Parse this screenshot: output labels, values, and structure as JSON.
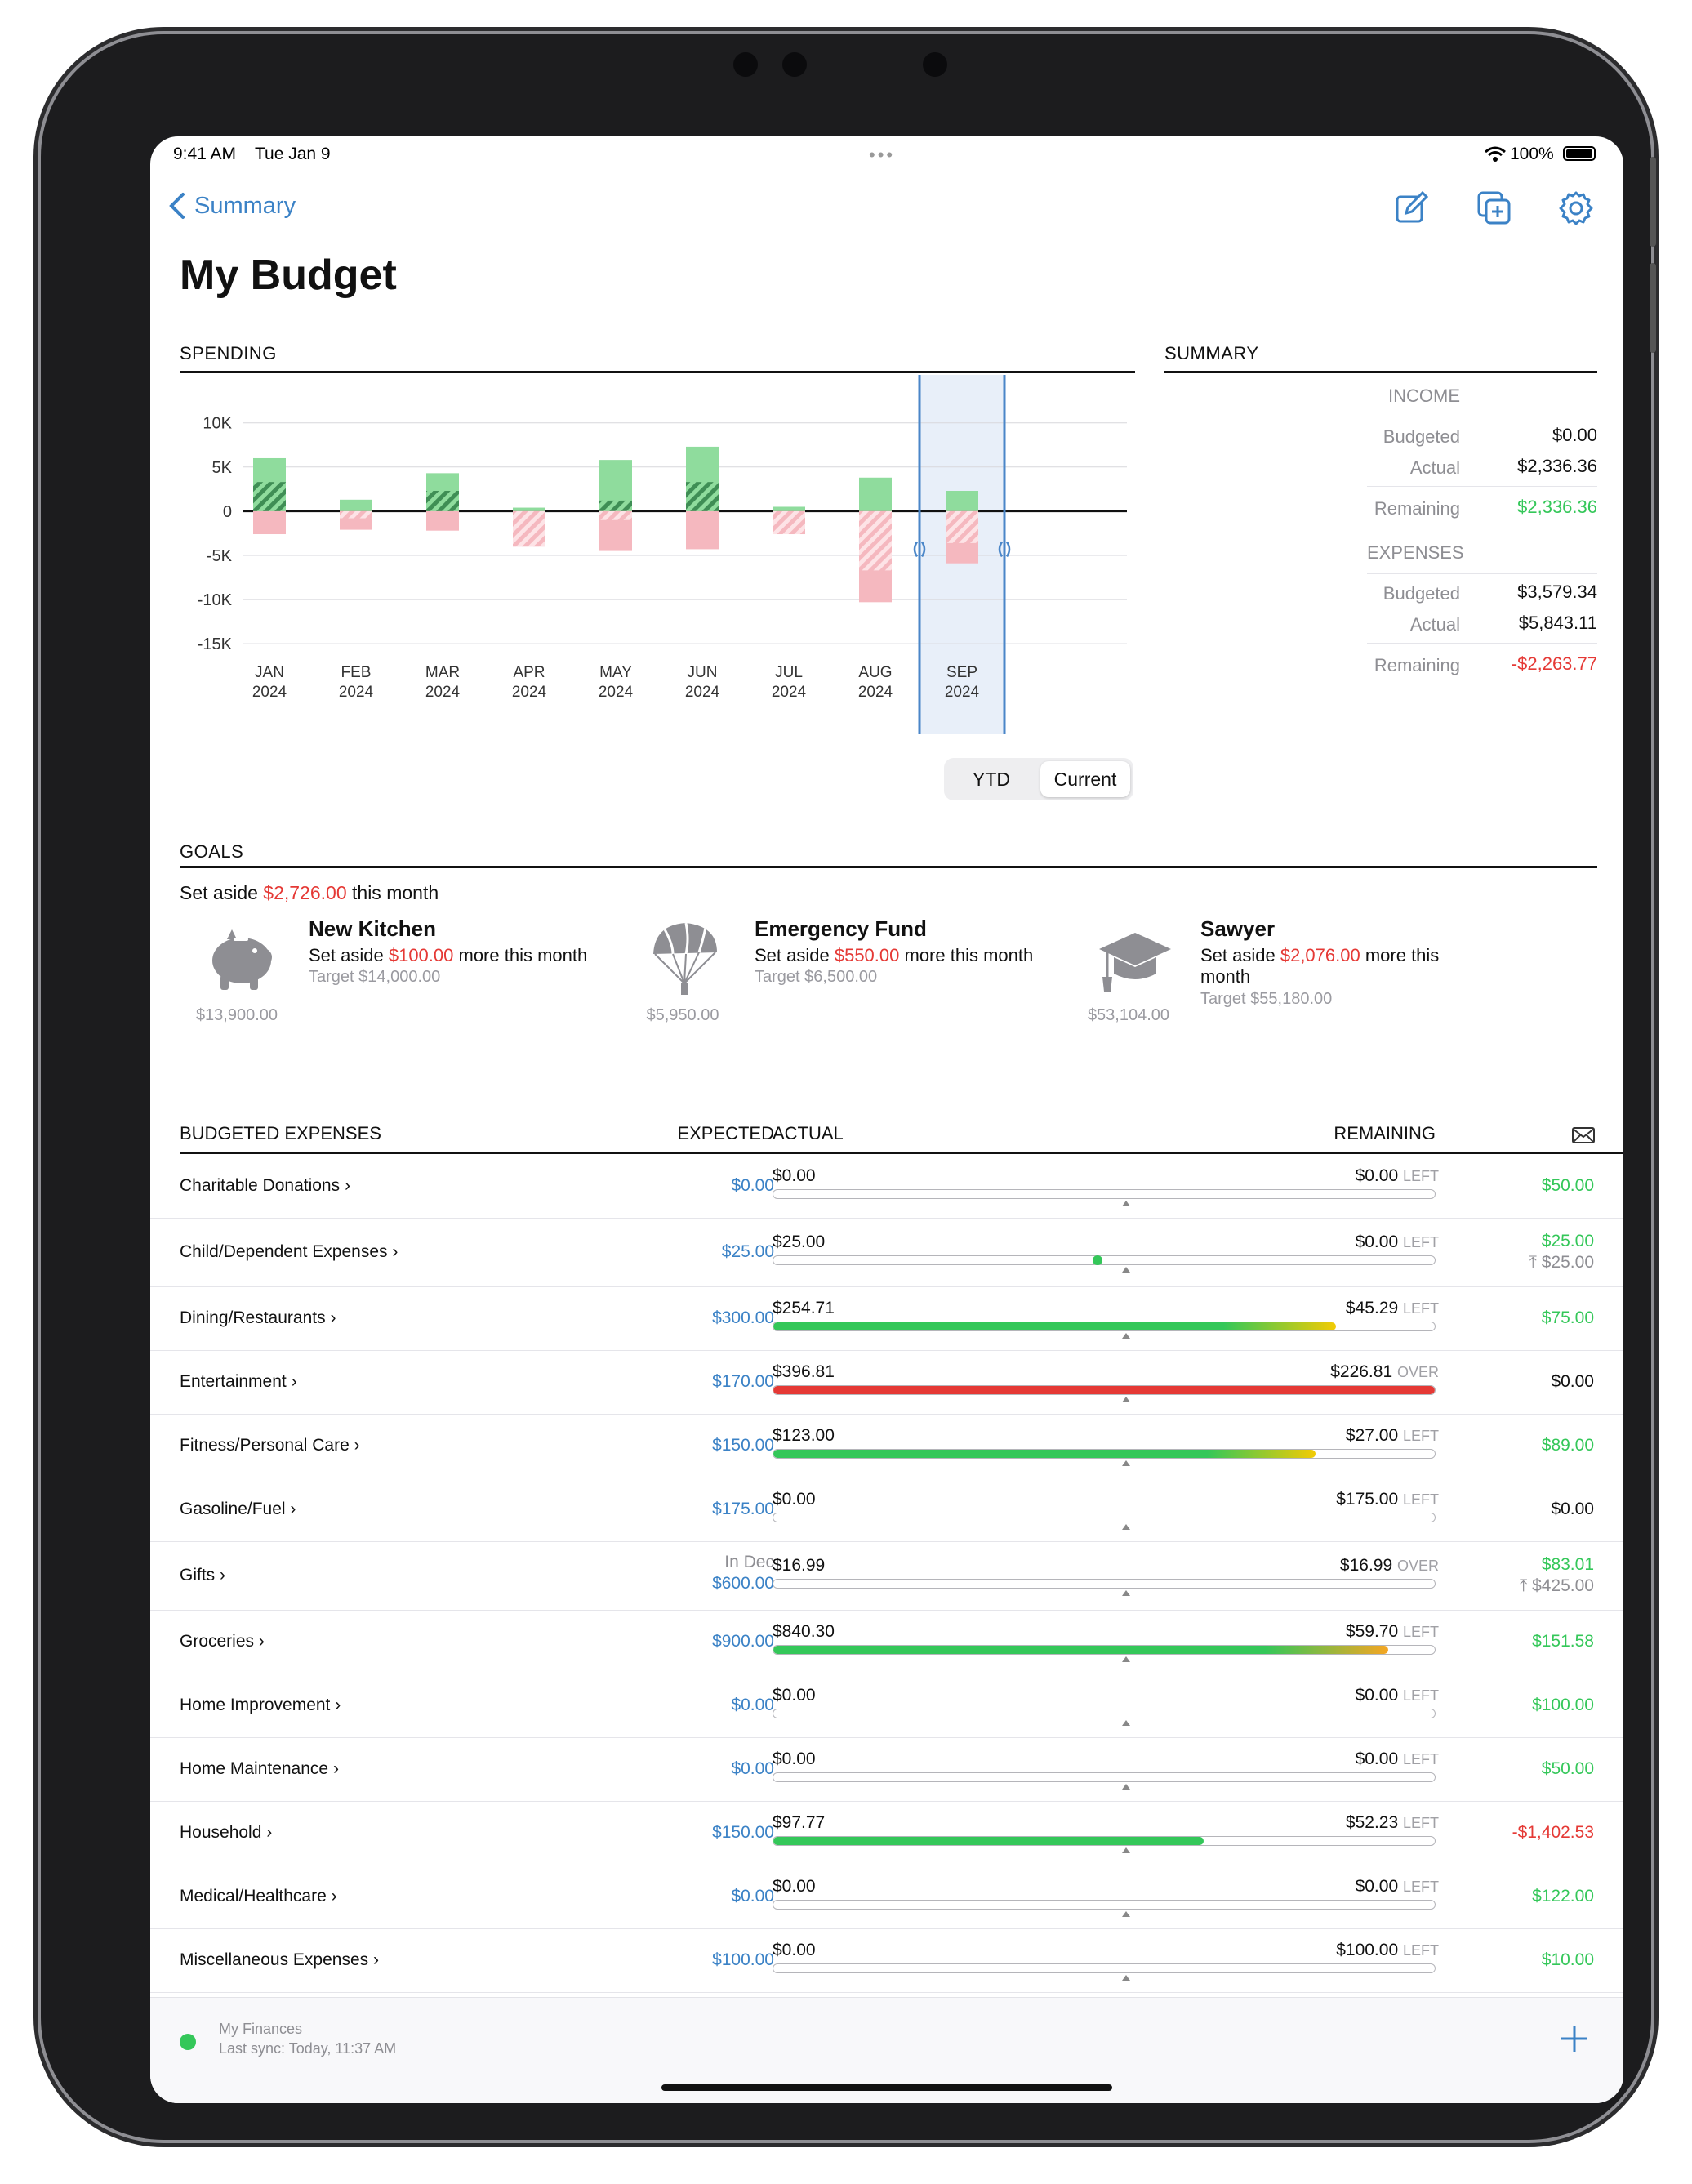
{
  "status": {
    "time": "9:41 AM",
    "date": "Tue Jan 9",
    "battery": "100%"
  },
  "nav": {
    "back_label": "Summary",
    "title": "My Budget"
  },
  "spending": {
    "section_label": "SPENDING",
    "toggle": {
      "options": [
        "YTD",
        "Current"
      ],
      "selected": "Current"
    }
  },
  "chart_data": {
    "type": "bar",
    "title": "",
    "categories": [
      "JAN\n2024",
      "FEB\n2024",
      "MAR\n2024",
      "APR\n2024",
      "MAY\n2024",
      "JUN\n2024",
      "JUL\n2024",
      "AUG\n2024",
      "SEP\n2024"
    ],
    "category_months": [
      "JAN",
      "FEB",
      "MAR",
      "APR",
      "MAY",
      "JUN",
      "JUL",
      "AUG",
      "SEP"
    ],
    "category_years": [
      "2024",
      "2024",
      "2024",
      "2024",
      "2024",
      "2024",
      "2024",
      "2024",
      "2024"
    ],
    "yticks": [
      "10K",
      "5K",
      "0",
      "-5K",
      "-10K",
      "-15K"
    ],
    "ytick_values": [
      10000,
      5000,
      0,
      -5000,
      -10000,
      -15000
    ],
    "ylim": [
      -16000,
      14500
    ],
    "series": [
      {
        "values": [
          6000,
          1300,
          4300,
          400,
          5800,
          7300,
          500,
          3800,
          2300
        ]
      },
      {
        "values": [
          3300,
          0,
          2300,
          0,
          1200,
          3300,
          0,
          0,
          0
        ]
      },
      {
        "values": [
          -2600,
          -2100,
          -2200,
          -4000,
          -4500,
          -4300,
          -2600,
          -10300,
          -5900
        ]
      },
      {
        "values": [
          0,
          -800,
          0,
          -4000,
          -1000,
          0,
          -2600,
          -6700,
          -3600
        ]
      }
    ],
    "selected_category": "SEP\n2024",
    "colors": {
      "income": "#8fdc9d",
      "income_hatch": "#3f8e55",
      "expense": "#f5b8bf",
      "selected_bg": "#e8eff9",
      "selected_line": "#4a86c8"
    }
  },
  "summary": {
    "section_label": "SUMMARY",
    "income": {
      "heading": "INCOME",
      "budgeted_label": "Budgeted",
      "budgeted": "$0.00",
      "actual_label": "Actual",
      "actual": "$2,336.36",
      "remaining_label": "Remaining",
      "remaining": "$2,336.36"
    },
    "expenses": {
      "heading": "EXPENSES",
      "budgeted_label": "Budgeted",
      "budgeted": "$3,579.34",
      "actual_label": "Actual",
      "actual": "$5,843.11",
      "remaining_label": "Remaining",
      "remaining": "-$2,263.77"
    }
  },
  "goals": {
    "section_label": "GOALS",
    "set_aside_prefix": "Set aside ",
    "set_aside_amount": "$2,726.00",
    "set_aside_suffix": " this month",
    "items": [
      {
        "icon": "piggy-bank-icon",
        "name": "New Kitchen",
        "line_prefix": "Set aside ",
        "amount": "$100.00",
        "line_suffix": " more this month",
        "target": "Target $14,000.00",
        "saved": "$13,900.00"
      },
      {
        "icon": "parachute-icon",
        "name": "Emergency Fund",
        "line_prefix": "Set aside ",
        "amount": "$550.00",
        "line_suffix": " more this month",
        "target": "Target $6,500.00",
        "saved": "$5,950.00"
      },
      {
        "icon": "graduation-cap-icon",
        "name": "Sawyer",
        "line_prefix": "Set aside ",
        "amount": "$2,076.00",
        "line_suffix": " more this month",
        "target": "Target $55,180.00",
        "saved": "$53,104.00"
      }
    ]
  },
  "expenses_table": {
    "headers": {
      "category": "BUDGETED EXPENSES",
      "expected": "EXPECTED",
      "actual": "ACTUAL",
      "remaining": "REMAINING"
    },
    "rows": [
      {
        "name": "Charitable Donations",
        "expected": "$0.00",
        "actual": "$0.00",
        "remaining": "$0.00",
        "rem_suffix": "LEFT",
        "progress": 0,
        "bar": "none",
        "right": "$50.00",
        "right_color": "green"
      },
      {
        "name": "Child/Dependent Expenses",
        "expected": "$25.00",
        "actual": "$25.00",
        "remaining": "$0.00",
        "rem_suffix": "LEFT",
        "progress": 0,
        "dot": 0.49,
        "bar": "none",
        "right": "$25.00",
        "right_color": "green",
        "right2": "$25.00"
      },
      {
        "name": "Dining/Restaurants",
        "expected": "$300.00",
        "actual": "$254.71",
        "remaining": "$45.29",
        "rem_suffix": "LEFT",
        "progress": 0.85,
        "bar": "green-yellow",
        "right": "$75.00",
        "right_color": "green"
      },
      {
        "name": "Entertainment",
        "expected": "$170.00",
        "actual": "$396.81",
        "remaining": "$226.81",
        "rem_suffix": "OVER",
        "progress": 1.0,
        "bar": "red",
        "right": "$0.00",
        "right_color": "black"
      },
      {
        "name": "Fitness/Personal Care",
        "expected": "$150.00",
        "actual": "$123.00",
        "remaining": "$27.00",
        "rem_suffix": "LEFT",
        "progress": 0.82,
        "bar": "green-yellow",
        "right": "$89.00",
        "right_color": "green"
      },
      {
        "name": "Gasoline/Fuel",
        "expected": "$175.00",
        "actual": "$0.00",
        "remaining": "$175.00",
        "rem_suffix": "LEFT",
        "progress": 0,
        "bar": "none",
        "right": "$0.00",
        "right_color": "black"
      },
      {
        "name": "Gifts",
        "expected_prefix": "In Dec",
        "expected": "$600.00",
        "actual": "$16.99",
        "remaining": "$16.99",
        "rem_suffix": "OVER",
        "progress": 0,
        "bar": "none",
        "right": "$83.01",
        "right_color": "green",
        "right2": "$425.00"
      },
      {
        "name": "Groceries",
        "expected": "$900.00",
        "actual": "$840.30",
        "remaining": "$59.70",
        "rem_suffix": "LEFT",
        "progress": 0.93,
        "bar": "green-orange",
        "right": "$151.58",
        "right_color": "green"
      },
      {
        "name": "Home Improvement",
        "expected": "$0.00",
        "actual": "$0.00",
        "remaining": "$0.00",
        "rem_suffix": "LEFT",
        "progress": 0,
        "bar": "none",
        "right": "$100.00",
        "right_color": "green"
      },
      {
        "name": "Home Maintenance",
        "expected": "$0.00",
        "actual": "$0.00",
        "remaining": "$0.00",
        "rem_suffix": "LEFT",
        "progress": 0,
        "bar": "none",
        "right": "$50.00",
        "right_color": "green"
      },
      {
        "name": "Household",
        "expected": "$150.00",
        "actual": "$97.77",
        "remaining": "$52.23",
        "rem_suffix": "LEFT",
        "progress": 0.65,
        "bar": "green",
        "right": "-$1,402.53",
        "right_color": "red"
      },
      {
        "name": "Medical/Healthcare",
        "expected": "$0.00",
        "actual": "$0.00",
        "remaining": "$0.00",
        "rem_suffix": "LEFT",
        "progress": 0,
        "bar": "none",
        "right": "$122.00",
        "right_color": "green"
      },
      {
        "name": "Miscellaneous Expenses",
        "expected": "$100.00",
        "actual": "$0.00",
        "remaining": "$100.00",
        "rem_suffix": "LEFT",
        "progress": 0,
        "bar": "none",
        "right": "$10.00",
        "right_color": "green"
      }
    ]
  },
  "footer": {
    "account": "My Finances",
    "sync": "Last sync: Today, 11:37 AM"
  }
}
